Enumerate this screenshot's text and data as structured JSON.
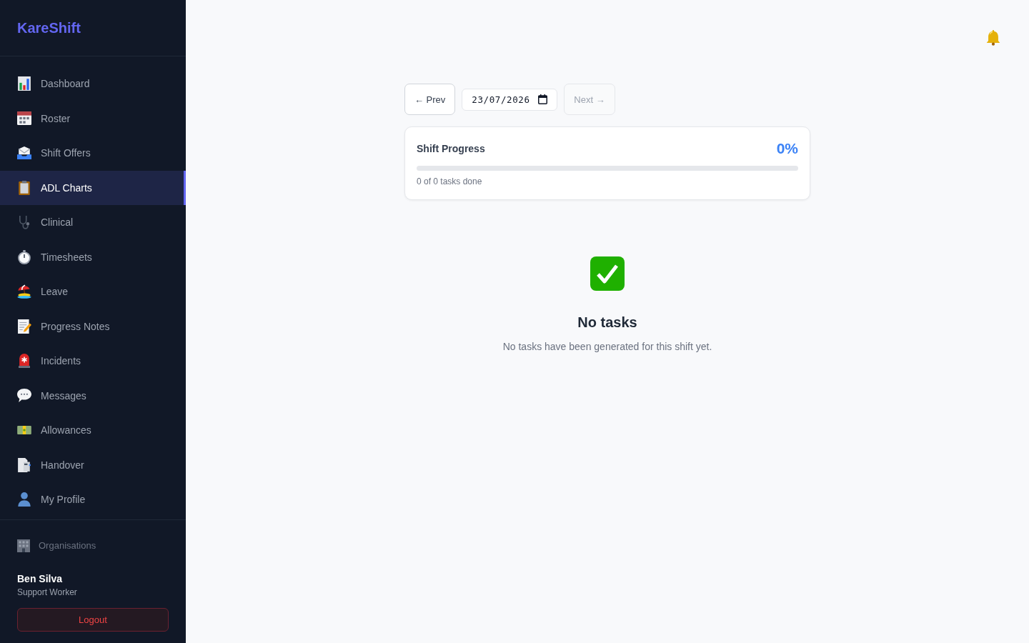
{
  "sidebar": {
    "logo": "KareShift",
    "nav_items": [
      {
        "label": "Dashboard",
        "selected": false
      },
      {
        "label": "Roster",
        "selected": false
      },
      {
        "label": "Shift Offers",
        "selected": false
      },
      {
        "label": "ADL Charts",
        "selected": true
      },
      {
        "label": "Clinical",
        "selected": false
      },
      {
        "label": "Timesheets",
        "selected": false
      },
      {
        "label": "Leave",
        "selected": false
      },
      {
        "label": "Progress Notes",
        "selected": false
      },
      {
        "label": "Incidents",
        "selected": false
      },
      {
        "label": "Messages",
        "selected": false
      },
      {
        "label": "Allowances",
        "selected": false
      },
      {
        "label": "Handover",
        "selected": false
      },
      {
        "label": "My Profile",
        "selected": false
      }
    ],
    "organisations": "Organisations",
    "user": {
      "name": "Ben Silva",
      "role": "Support Worker"
    },
    "logout_button": "Logout"
  },
  "date_nav": {
    "prev": {
      "label": "← Prev",
      "disabled": false
    },
    "date": "23/07/2026",
    "next": {
      "label": "Next →",
      "disabled": true
    }
  },
  "progress_card": {
    "title": "Shift Progress",
    "percent": "0%",
    "level": 0,
    "caption": "0 of 0 tasks done"
  },
  "empty_state": {
    "title": "No tasks",
    "message": "No tasks have been generated for this shift yet."
  }
}
